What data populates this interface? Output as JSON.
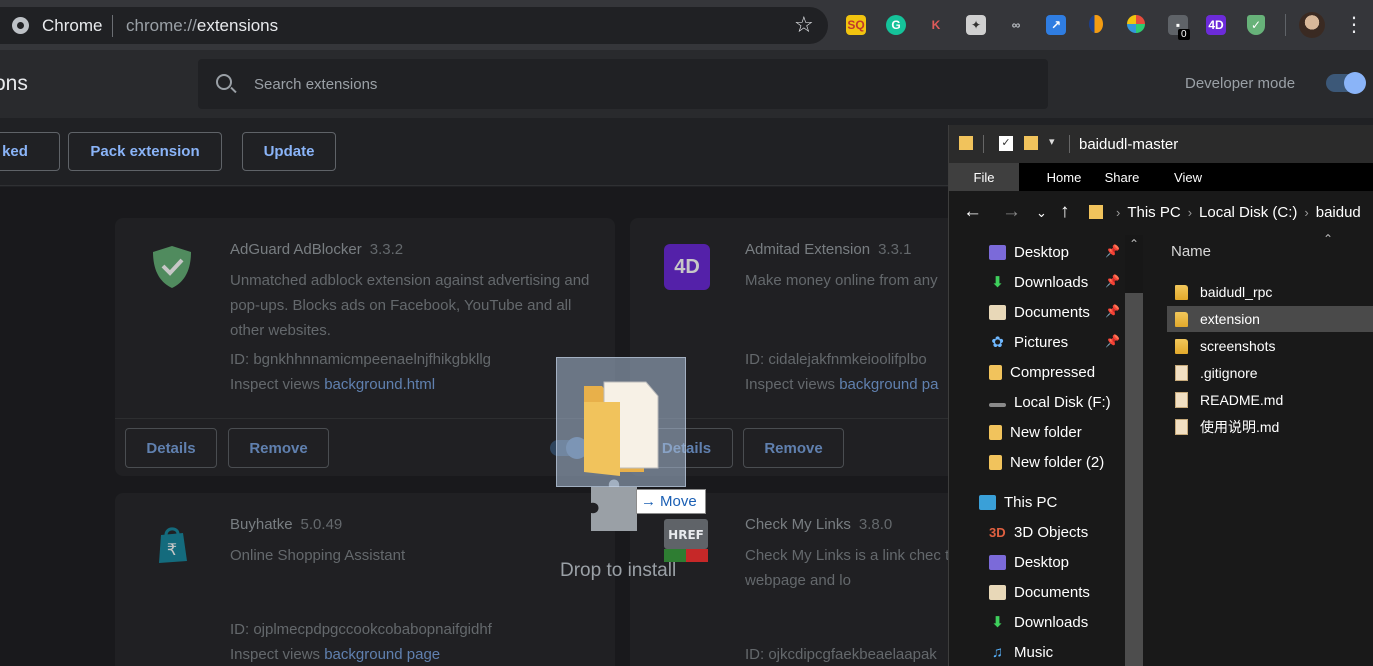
{
  "chrome": {
    "omnibox_label": "Chrome",
    "url_scheme": "chrome://",
    "url_path": "extensions",
    "toolbar_badge": "0",
    "colors": {
      "accent_blue": "#8ab4f8",
      "toolbar_bg": "#35363a",
      "page_bg": "#202124"
    }
  },
  "extensions_page": {
    "title": "ons",
    "search_placeholder": "Search extensions",
    "developer_mode_label": "Developer mode",
    "developer_mode": true,
    "actions": {
      "load_unpacked": "ked",
      "pack": "Pack extension",
      "update": "Update"
    },
    "cards": [
      {
        "name": "AdGuard AdBlocker",
        "version": "3.3.2",
        "description": "Unmatched adblock extension against advertising and pop-ups. Blocks ads on Facebook, YouTube and all other websites.",
        "id": "ID: bgnkhhnnamicmpeenaelnjfhikgbkllg",
        "inspect_prefix": "Inspect views ",
        "inspect_link": "background.html",
        "details": "Details",
        "remove": "Remove",
        "icon": "adguard-shield-icon"
      },
      {
        "name": "Admitad Extension",
        "version": "3.3.1",
        "description": "Make money online from any",
        "id": "ID: cidalejakfnmkeioolifplbo",
        "inspect_prefix": "Inspect views ",
        "inspect_link": "background pa",
        "details": "Details",
        "remove": "Remove",
        "icon": "admitad-icon"
      },
      {
        "name": "Buyhatke",
        "version": "5.0.49",
        "description": "Online Shopping Assistant",
        "id": "ID: ojplmecpdpgccookcobabopnaifgidhf",
        "inspect_prefix": "Inspect views ",
        "inspect_link": "background page",
        "icon": "buyhatke-bag-icon"
      },
      {
        "name": "Check My Links",
        "version": "3.8.0",
        "description": "Check My Links is a link chec through your webpage and lo",
        "id": "ID: ojkcdipcgfaekbeaelaapak",
        "icon": "check-my-links-icon"
      }
    ],
    "drop_label": "Drop to install",
    "move_tip": "Move",
    "href_badge": "HREF"
  },
  "explorer": {
    "title": "baidudl-master",
    "ribbon_tabs": [
      "File",
      "Home",
      "Share",
      "View"
    ],
    "breadcrumbs": [
      "This PC",
      "Local Disk (C:)",
      "baidud"
    ],
    "quick_access": [
      {
        "label": "Desktop",
        "pinned": true,
        "icon": "desktop-icon"
      },
      {
        "label": "Downloads",
        "pinned": true,
        "icon": "downloads-icon"
      },
      {
        "label": "Documents",
        "pinned": true,
        "icon": "documents-icon"
      },
      {
        "label": "Pictures",
        "pinned": true,
        "icon": "pictures-icon"
      },
      {
        "label": "Compressed",
        "pinned": false,
        "icon": "folder-icon"
      },
      {
        "label": "Local Disk (F:)",
        "pinned": false,
        "icon": "drive-icon"
      },
      {
        "label": "New folder",
        "pinned": false,
        "icon": "folder-icon"
      },
      {
        "label": "New folder (2)",
        "pinned": false,
        "icon": "folder-icon"
      }
    ],
    "this_pc_label": "This PC",
    "this_pc_items": [
      {
        "label": "3D Objects",
        "icon": "3d-objects-icon"
      },
      {
        "label": "Desktop",
        "icon": "desktop-icon"
      },
      {
        "label": "Documents",
        "icon": "documents-icon"
      },
      {
        "label": "Downloads",
        "icon": "downloads-icon"
      },
      {
        "label": "Music",
        "icon": "music-icon"
      }
    ],
    "column_header": "Name",
    "files": [
      {
        "name": "baidudl_rpc",
        "type": "folder"
      },
      {
        "name": "extension",
        "type": "folder",
        "selected": true
      },
      {
        "name": "screenshots",
        "type": "folder"
      },
      {
        "name": ".gitignore",
        "type": "file"
      },
      {
        "name": "README.md",
        "type": "file"
      },
      {
        "name": "使用说明.md",
        "type": "file"
      }
    ]
  }
}
